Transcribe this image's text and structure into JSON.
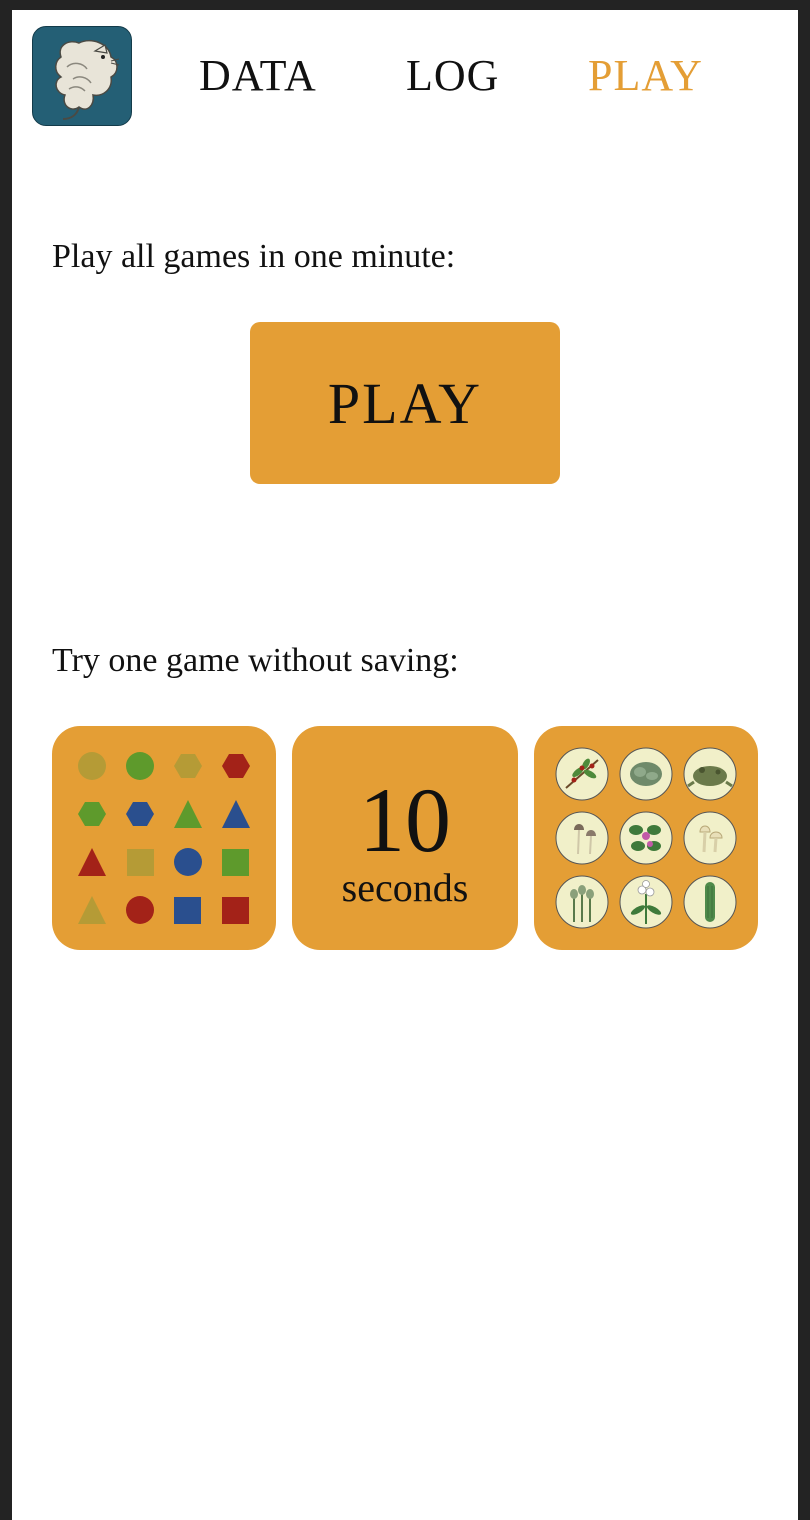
{
  "nav": {
    "items": [
      {
        "label": "DATA",
        "active": false
      },
      {
        "label": "LOG",
        "active": false
      },
      {
        "label": "PLAY",
        "active": true
      }
    ],
    "active_color": "#e49e35"
  },
  "play_all": {
    "heading": "Play all games in one minute:",
    "button_label": "PLAY"
  },
  "try_one": {
    "heading": "Try one game without saving:",
    "games": [
      {
        "id": "shapes-game",
        "icons": [
          "olive-circle",
          "green-circle",
          "olive-hexagon",
          "red-hexagon",
          "green-hexagon",
          "blue-hexagon",
          "green-triangle",
          "blue-triangle",
          "red-triangle",
          "olive-square",
          "blue-circle",
          "green-square",
          "olive-triangle",
          "red-circle",
          "blue-square",
          "red-square"
        ]
      },
      {
        "id": "timer-game",
        "value": "10",
        "unit": "seconds"
      },
      {
        "id": "nature-game",
        "icons": [
          "berry-branch-icon",
          "lichen-icon",
          "toad-icon",
          "mushroom-icon",
          "flowering-plant-icon",
          "fungi-cluster-icon",
          "seed-pods-icon",
          "lily-icon",
          "cactus-icon"
        ]
      }
    ]
  },
  "colors": {
    "accent": "#e49e35",
    "shape_red": "#a32218",
    "shape_green": "#5e9a2c",
    "shape_blue": "#2a4f8e",
    "shape_olive": "#b59b36",
    "logo_bg": "#245f75",
    "icon_bg": "#f1f0c9"
  }
}
